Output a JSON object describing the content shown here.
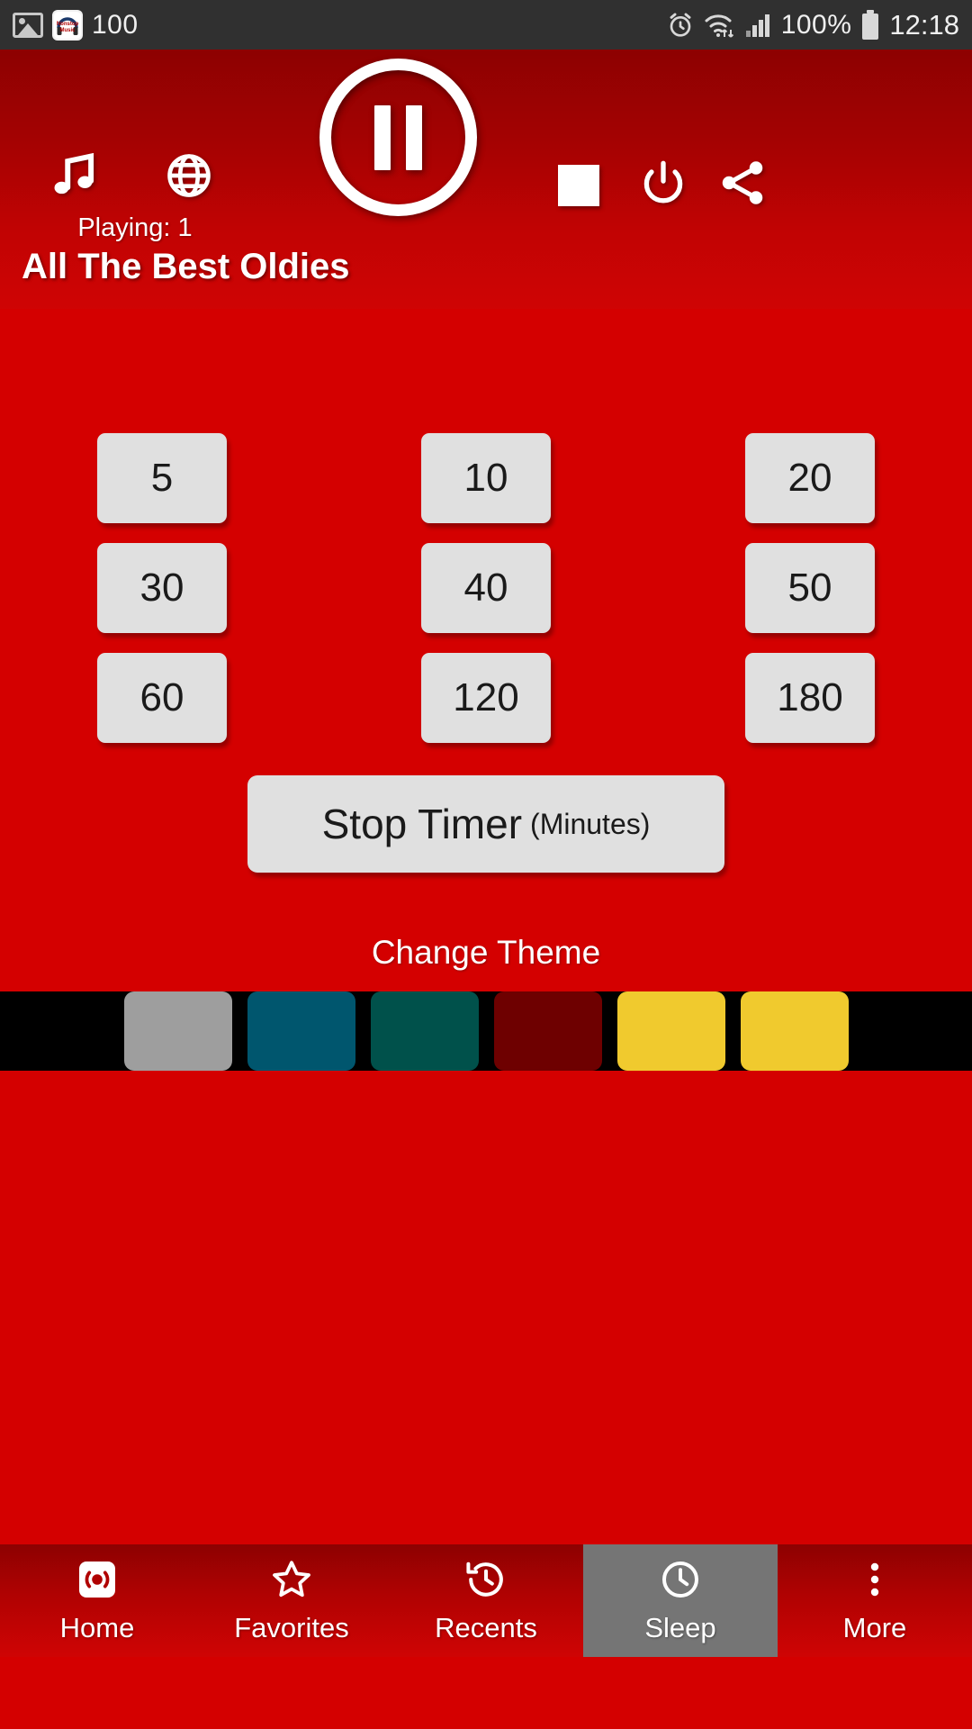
{
  "status_bar": {
    "notification_count": "100",
    "app_icon_label": "Nonstop Music",
    "battery_percent": "100%",
    "time": "12:18",
    "icons": [
      "gallery-icon",
      "app-icon",
      "alarm-icon",
      "wifi-icon",
      "signal-icon",
      "battery-icon"
    ]
  },
  "header": {
    "music_icon": "music-note-icon",
    "globe_icon": "globe-icon",
    "playing_status": "Playing: 1",
    "play_pause_state": "pause",
    "stop_icon": "stop-icon",
    "power_icon": "power-icon",
    "share_icon": "share-icon",
    "station_name": "All The Best Oldies",
    "background_color": "#a40202"
  },
  "main": {
    "background_color": "#d40000",
    "timer_buttons": [
      "5",
      "10",
      "20",
      "30",
      "40",
      "50",
      "60",
      "120",
      "180"
    ],
    "stop_timer": {
      "main_label": "Stop Timer",
      "sub_label": "(Minutes)"
    },
    "theme": {
      "title": "Change Theme",
      "swatches": [
        {
          "name": "black",
          "color": "#000000"
        },
        {
          "name": "gray",
          "color": "#9e9e9e"
        },
        {
          "name": "blue",
          "color": "#00566e"
        },
        {
          "name": "green",
          "color": "#00514b"
        },
        {
          "name": "maroon",
          "color": "#6e0000"
        },
        {
          "name": "yellow",
          "color": "#f0ca2e"
        }
      ]
    }
  },
  "bottom_nav": {
    "active_index": 3,
    "items": [
      {
        "label": "Home",
        "icon": "broadcast-icon"
      },
      {
        "label": "Favorites",
        "icon": "star-icon"
      },
      {
        "label": "Recents",
        "icon": "history-icon"
      },
      {
        "label": "Sleep",
        "icon": "clock-icon"
      },
      {
        "label": "More",
        "icon": "more-vertical-icon"
      }
    ]
  }
}
